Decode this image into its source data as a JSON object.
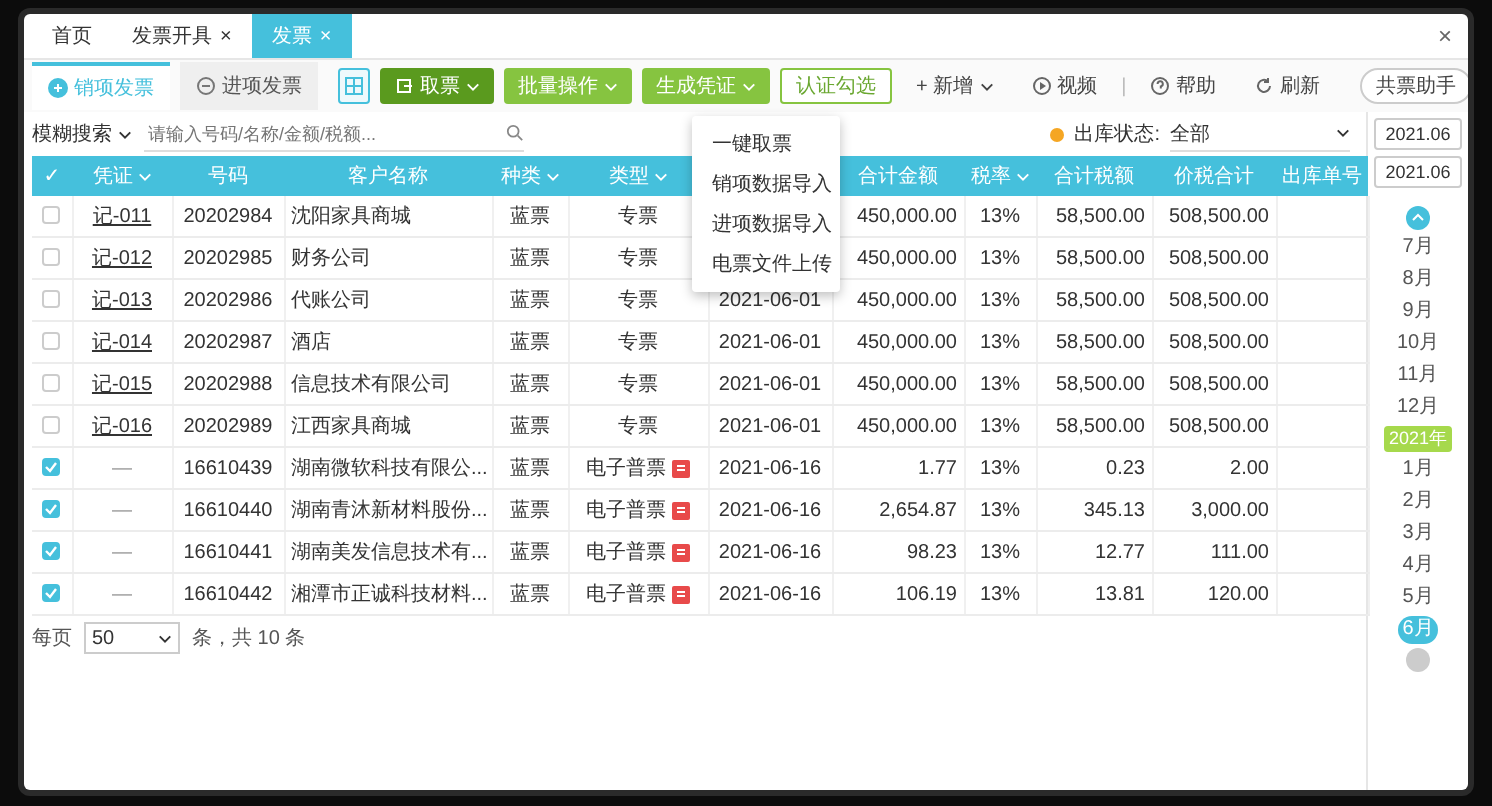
{
  "tabs": [
    {
      "label": "首页",
      "selected": false
    },
    {
      "label": "发票开具",
      "close": "×",
      "selected": false
    },
    {
      "label": "发票",
      "close": "×",
      "selected": true
    }
  ],
  "window_close": "×",
  "subtabs": [
    {
      "label": "销项发票",
      "selected": true
    },
    {
      "label": "进项发票",
      "selected": false
    }
  ],
  "toolbar": [
    {
      "kind": "icon"
    },
    {
      "kind": "dark",
      "label": "取票",
      "dropdown": true
    },
    {
      "kind": "green",
      "label": "批量操作",
      "dropdown": true
    },
    {
      "kind": "green",
      "label": "生成凭证",
      "dropdown": true
    },
    {
      "kind": "outline",
      "label": "认证勾选",
      "dropdown": false
    },
    {
      "kind": "plain",
      "label": "+ 新增",
      "dropdown": true
    },
    {
      "kind": "video",
      "label": "视频",
      "dropdown": false
    },
    {
      "kind": "separator",
      "label": "|"
    },
    {
      "kind": "help",
      "label": "帮助",
      "dropdown": false
    },
    {
      "kind": "refresh",
      "label": "刷新",
      "dropdown": false
    },
    {
      "kind": "assistant",
      "label": "共票助手",
      "dropdown": false
    }
  ],
  "menu": [
    "一键取票",
    "销项数据导入",
    "进项数据导入",
    "电票文件上传"
  ],
  "filter": {
    "mode": "模糊搜索",
    "placeholder": "请输入号码/名称/金额/税额...",
    "status_label": "出库状态:",
    "status_value": "全部"
  },
  "table": {
    "columns": [
      {
        "label": "✓"
      },
      {
        "label": "凭证",
        "sortable": true
      },
      {
        "label": "号码"
      },
      {
        "label": "客户名称"
      },
      {
        "label": "种类",
        "sortable": true
      },
      {
        "label": "类型",
        "sortable": true
      },
      {},
      {
        "label": "合计金额"
      },
      {
        "label": "税率",
        "sortable": true
      },
      {
        "label": "合计税额"
      },
      {
        "label": "价税合计"
      },
      {
        "label": "出库单号"
      }
    ],
    "rows": [
      {
        "checked": false,
        "voucher": "记-011",
        "link": true,
        "number": "20202984",
        "customer": "沈阳家具商城",
        "category": "蓝票",
        "type": "专票",
        "e_mark": false,
        "amount": "450,000.00",
        "rate": "13%",
        "tax": "58,500.00",
        "total": "508,500.00"
      },
      {
        "checked": false,
        "voucher": "记-012",
        "link": true,
        "number": "20202985",
        "customer": "财务公司",
        "category": "蓝票",
        "type": "专票",
        "e_mark": false,
        "amount": "450,000.00",
        "rate": "13%",
        "tax": "58,500.00",
        "total": "508,500.00"
      },
      {
        "checked": false,
        "voucher": "记-013",
        "link": true,
        "number": "20202986",
        "customer": "代账公司",
        "category": "蓝票",
        "type": "专票",
        "e_mark": false,
        "date": "2021-06-01",
        "amount": "450,000.00",
        "rate": "13%",
        "tax": "58,500.00",
        "total": "508,500.00"
      },
      {
        "checked": false,
        "voucher": "记-014",
        "link": true,
        "number": "20202987",
        "customer": "酒店",
        "category": "蓝票",
        "type": "专票",
        "e_mark": false,
        "date": "2021-06-01",
        "amount": "450,000.00",
        "rate": "13%",
        "tax": "58,500.00",
        "total": "508,500.00"
      },
      {
        "checked": false,
        "voucher": "记-015",
        "link": true,
        "number": "20202988",
        "customer": "信息技术有限公司",
        "category": "蓝票",
        "type": "专票",
        "e_mark": false,
        "date": "2021-06-01",
        "amount": "450,000.00",
        "rate": "13%",
        "tax": "58,500.00",
        "total": "508,500.00"
      },
      {
        "checked": false,
        "voucher": "记-016",
        "link": true,
        "number": "20202989",
        "customer": "江西家具商城",
        "category": "蓝票",
        "type": "专票",
        "e_mark": false,
        "date": "2021-06-01",
        "amount": "450,000.00",
        "rate": "13%",
        "tax": "58,500.00",
        "total": "508,500.00"
      },
      {
        "checked": true,
        "voucher": "—",
        "link": false,
        "number": "16610439",
        "customer": "湖南微软科技有限公...",
        "category": "蓝票",
        "type": "电子普票",
        "e_mark": true,
        "date": "2021-06-16",
        "amount": "1.77",
        "rate": "13%",
        "tax": "0.23",
        "total": "2.00"
      },
      {
        "checked": true,
        "voucher": "—",
        "link": false,
        "number": "16610440",
        "customer": "湖南青沐新材料股份...",
        "category": "蓝票",
        "type": "电子普票",
        "e_mark": true,
        "date": "2021-06-16",
        "amount": "2,654.87",
        "rate": "13%",
        "tax": "345.13",
        "total": "3,000.00"
      },
      {
        "checked": true,
        "voucher": "—",
        "link": false,
        "number": "16610441",
        "customer": "湖南美发信息技术有...",
        "category": "蓝票",
        "type": "电子普票",
        "e_mark": true,
        "date": "2021-06-16",
        "amount": "98.23",
        "rate": "13%",
        "tax": "12.77",
        "total": "111.00"
      },
      {
        "checked": true,
        "voucher": "—",
        "link": false,
        "number": "16610442",
        "customer": "湘潭市正诚科技材料...",
        "category": "蓝票",
        "type": "电子普票",
        "e_mark": true,
        "date": "2021-06-16",
        "amount": "106.19",
        "rate": "13%",
        "tax": "13.81",
        "total": "120.00"
      }
    ]
  },
  "pagination": {
    "per_page_label": "每页",
    "per_page": "50",
    "summary": "条，共 10 条"
  },
  "sidebar": {
    "dates": [
      "2021.06",
      "2021.06"
    ],
    "items": [
      {
        "kind": "top"
      },
      {
        "kind": "month",
        "label": "7月",
        "selected": false
      },
      {
        "kind": "month",
        "label": "8月",
        "selected": false
      },
      {
        "kind": "month",
        "label": "9月",
        "selected": false
      },
      {
        "kind": "month",
        "label": "10月",
        "selected": false
      },
      {
        "kind": "month",
        "label": "11月",
        "selected": false
      },
      {
        "kind": "month",
        "label": "12月",
        "selected": false
      },
      {
        "kind": "year",
        "label": "2021年"
      },
      {
        "kind": "month",
        "label": "1月",
        "selected": false
      },
      {
        "kind": "month",
        "label": "2月",
        "selected": false
      },
      {
        "kind": "month",
        "label": "3月",
        "selected": false
      },
      {
        "kind": "month",
        "label": "4月",
        "selected": false
      },
      {
        "kind": "month",
        "label": "5月",
        "selected": false
      },
      {
        "kind": "month",
        "label": "6月",
        "selected": true
      },
      {
        "kind": "bottom"
      }
    ]
  }
}
